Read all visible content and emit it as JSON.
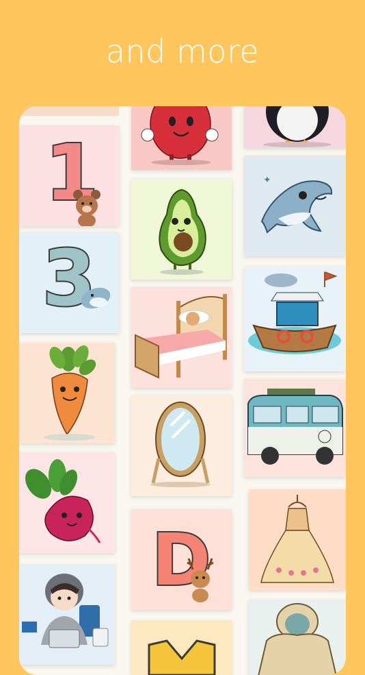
{
  "header": {
    "title": "and more"
  },
  "gallery": {
    "tiles": [
      {
        "name": "apple-character",
        "bg": "#f9c7c4"
      },
      {
        "name": "penguin",
        "bg": "#f6d6df"
      },
      {
        "name": "number-one-bear",
        "bg": "#fde0e1",
        "glyph": "1",
        "glyph_color": "#f48a88"
      },
      {
        "name": "avocado",
        "bg": "#f0f7d6"
      },
      {
        "name": "dolphin",
        "bg": "#dfeaf0"
      },
      {
        "name": "number-three-dolphin",
        "bg": "#e2f1f7",
        "glyph": "3",
        "glyph_color": "#9fc4c7"
      },
      {
        "name": "bed",
        "bg": "#fde1dc"
      },
      {
        "name": "boat",
        "bg": "#e7f3f8"
      },
      {
        "name": "carrot",
        "bg": "#fde4d2"
      },
      {
        "name": "mirror",
        "bg": "#fdeddf"
      },
      {
        "name": "camper-van",
        "bg": "#fde3dc"
      },
      {
        "name": "beet",
        "bg": "#fde4e6"
      },
      {
        "name": "letter-d-deer",
        "bg": "#fde0d7",
        "glyph": "D",
        "glyph_color": "#f38474"
      },
      {
        "name": "dress",
        "bg": "#fdddc6"
      },
      {
        "name": "person-laptop",
        "bg": "#e3eef6"
      },
      {
        "name": "letter-partial",
        "bg": "#fde9c0"
      },
      {
        "name": "hoodie",
        "bg": "#e9f1ee"
      }
    ]
  }
}
